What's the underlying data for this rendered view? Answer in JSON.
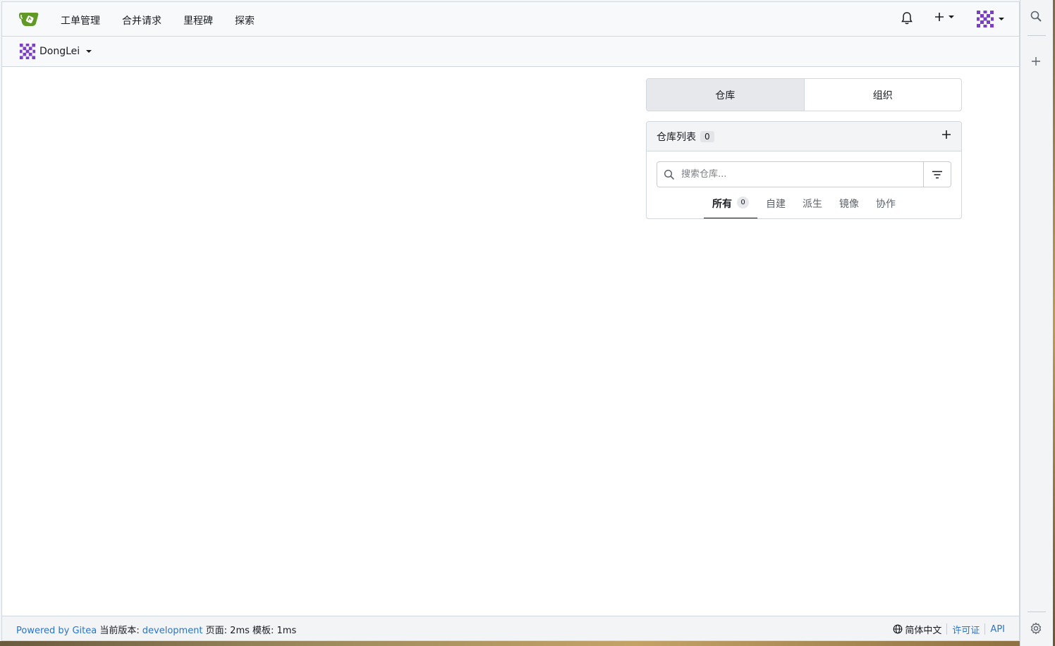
{
  "nav": {
    "items": [
      "工单管理",
      "合并请求",
      "里程碑",
      "探索"
    ]
  },
  "context": {
    "user": "DongLei"
  },
  "dashboard_tabs": [
    "仓库",
    "组织"
  ],
  "repo_list": {
    "title": "仓库列表",
    "count": "0",
    "search_placeholder": "搜索仓库...",
    "filters": [
      {
        "label": "所有",
        "count": "0"
      },
      {
        "label": "自建"
      },
      {
        "label": "派生"
      },
      {
        "label": "镜像"
      },
      {
        "label": "协作"
      }
    ]
  },
  "footer": {
    "powered": "Powered by Gitea",
    "version_label": "当前版本:",
    "version": "development",
    "timing": "页面: 2ms 模板: 1ms",
    "language": "简体中文",
    "license": "许可证",
    "api": "API"
  },
  "colors": {
    "brand": "#609926",
    "avatar": "#7b3fc6",
    "link": "#2b74c7"
  }
}
